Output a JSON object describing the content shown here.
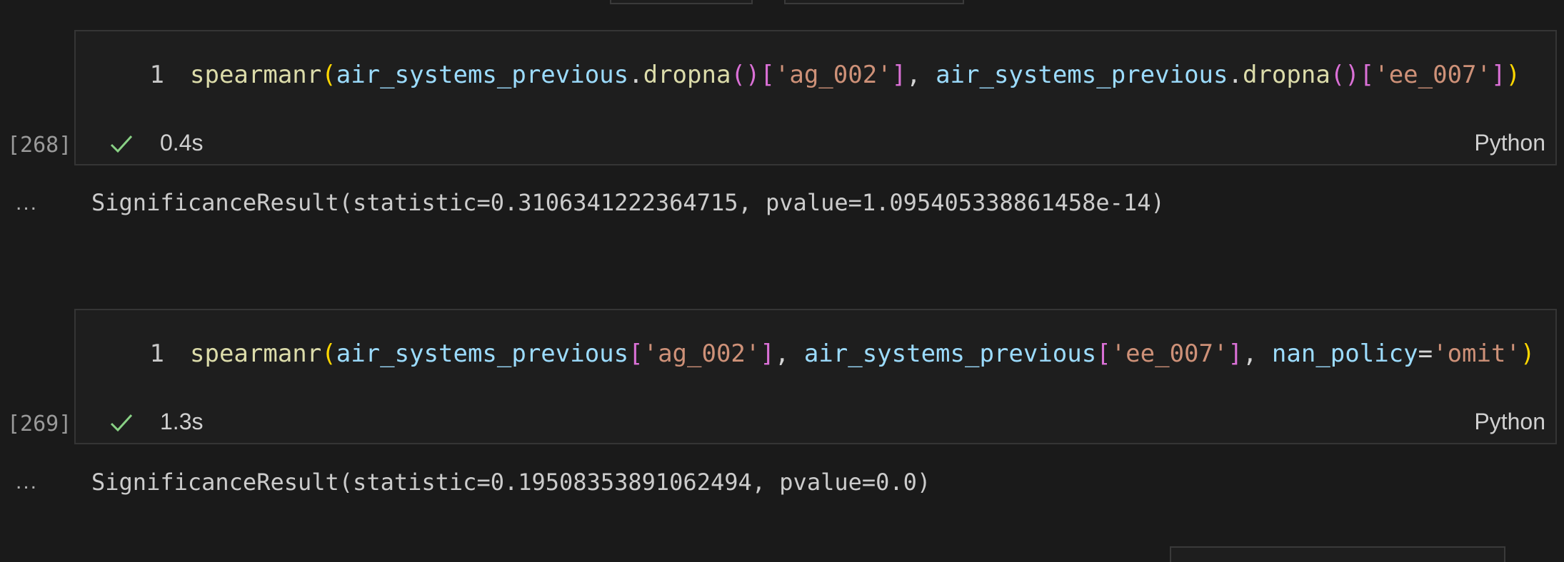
{
  "cells": [
    {
      "execution_count": "[268]",
      "line_number": "1",
      "code": {
        "fn": "spearmanr",
        "open_paren": "(",
        "arg1_var": "air_systems_previous",
        "arg1_dot": ".",
        "arg1_method": "dropna",
        "arg1_call": "()",
        "arg1_open_bracket": "[",
        "arg1_key": "'ag_002'",
        "arg1_close_bracket": "]",
        "sep": ", ",
        "arg2_var": "air_systems_previous",
        "arg2_dot": ".",
        "arg2_method": "dropna",
        "arg2_call": "()",
        "arg2_open_bracket": "[",
        "arg2_key": "'ee_007'",
        "arg2_close_bracket": "]",
        "close_paren": ")"
      },
      "status_icon": "checkmark-icon",
      "duration": "0.4s",
      "language": "Python",
      "output_prompt": "...",
      "output": "SignificanceResult(statistic=0.3106341222364715, pvalue=1.095405338861458e-14)"
    },
    {
      "execution_count": "[269]",
      "line_number": "1",
      "code": {
        "fn": "spearmanr",
        "open_paren": "(",
        "arg1_var": "air_systems_previous",
        "arg1_open_bracket": "[",
        "arg1_key": "'ag_002'",
        "arg1_close_bracket": "]",
        "sep": ", ",
        "arg2_var": "air_systems_previous",
        "arg2_open_bracket": "[",
        "arg2_key": "'ee_007'",
        "arg2_close_bracket": "]",
        "sep2": ", ",
        "kw_name": "nan_policy",
        "kw_eq": "=",
        "kw_value": "'omit'",
        "close_paren": ")"
      },
      "status_icon": "checkmark-icon",
      "duration": "1.3s",
      "language": "Python",
      "output_prompt": "...",
      "output": "SignificanceResult(statistic=0.19508353891062494, pvalue=0.0)"
    }
  ],
  "colors": {
    "background": "#1a1a1a",
    "cell_border": "#353535",
    "function": "#dcdcaa",
    "variable": "#9cdcfe",
    "string": "#ce9178",
    "success_check": "#89d185"
  }
}
